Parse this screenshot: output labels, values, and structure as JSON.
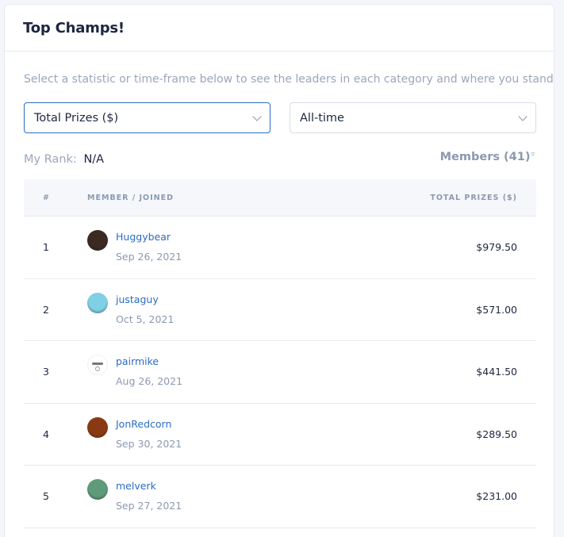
{
  "header": {
    "title": "Top Champs!"
  },
  "intro": "Select a statistic or time-frame below to see the leaders in each category and where you stand!",
  "filters": {
    "statistic": "Total Prizes ($)",
    "timeframe": "All-time"
  },
  "my_rank": {
    "label": "My Rank:",
    "value": "N/A"
  },
  "members": {
    "label": "Members (41)",
    "sort_icon": "triangle-down"
  },
  "table": {
    "columns": [
      "#",
      "MEMBER / JOINED",
      "TOTAL PRIZES ($)"
    ],
    "rows": [
      {
        "rank": "1",
        "name": "Huggybear",
        "joined": "Sep 26, 2021",
        "prize": "$979.50",
        "avatar_color": "#3a2a22"
      },
      {
        "rank": "2",
        "name": "justaguy",
        "joined": "Oct 5, 2021",
        "prize": "$571.00",
        "avatar_color": "#7fd0e4"
      },
      {
        "rank": "3",
        "name": "pairmike",
        "joined": "Aug 26, 2021",
        "prize": "$441.50",
        "avatar_color": "#ffffff"
      },
      {
        "rank": "4",
        "name": "JonRedcorn",
        "joined": "Sep 30, 2021",
        "prize": "$289.50",
        "avatar_color": "#8a3a12"
      },
      {
        "rank": "5",
        "name": "melverk",
        "joined": "Sep 27, 2021",
        "prize": "$231.00",
        "avatar_color": "#5f9a7a"
      }
    ]
  },
  "colors": {
    "link": "#2a6dc4",
    "muted": "#8b99b0",
    "text": "#1c2740"
  }
}
